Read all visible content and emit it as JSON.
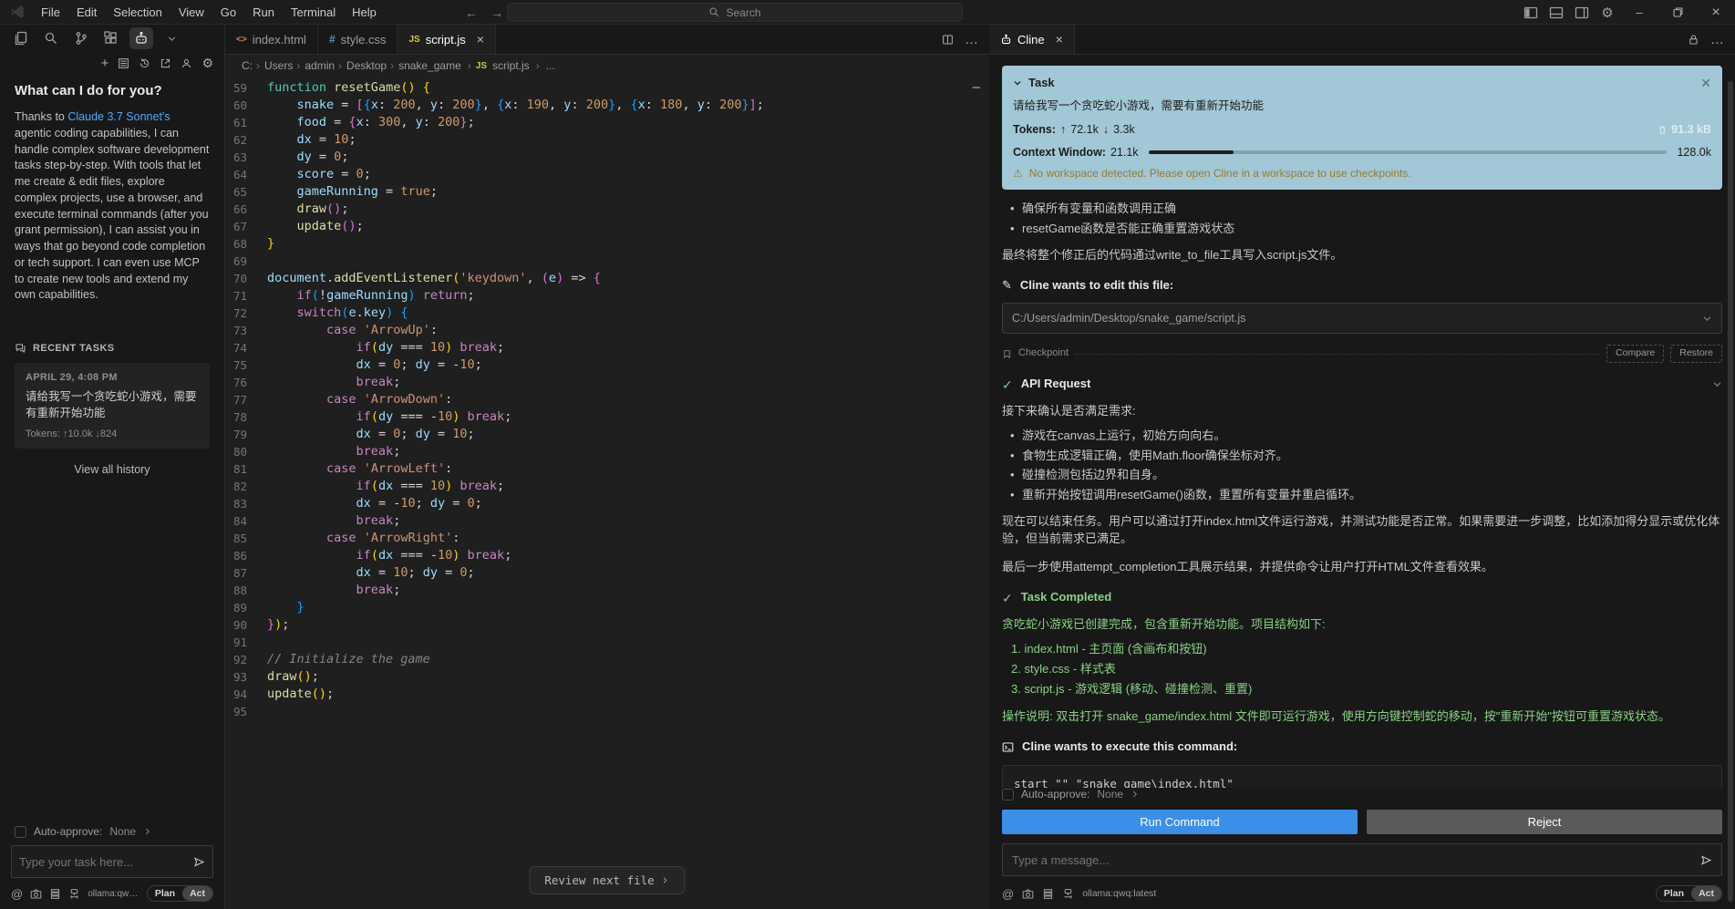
{
  "titlebar": {
    "menus": [
      "File",
      "Edit",
      "Selection",
      "View",
      "Go",
      "Run",
      "Terminal",
      "Help"
    ],
    "search_placeholder": "Search"
  },
  "sidebar": {
    "welcome_title": "What can I do for you?",
    "welcome_pre": "Thanks to ",
    "welcome_link": "Claude 3.7 Sonnet's",
    "welcome_post": " agentic coding capabilities, I can handle complex software development tasks step-by-step. With tools that let me create & edit files, explore complex projects, use a browser, and execute terminal commands (after you grant permission), I can assist you in ways that go beyond code completion or tech support. I can even use MCP to create new tools and extend my own capabilities.",
    "recent_tasks_label": "RECENT TASKS",
    "task_card": {
      "date": "APRIL 29, 4:08 PM",
      "text": "请给我写一个贪吃蛇小游戏，需要有重新开始功能",
      "tokens": "Tokens: ↑10.0k ↓824"
    },
    "view_all_history": "View all history",
    "auto_approve_label": "Auto-approve:",
    "auto_approve_value": "None",
    "input_placeholder": "Type your task here...",
    "model_label": "ollama:qwq:la...",
    "plan_label": "Plan",
    "act_label": "Act"
  },
  "editor": {
    "tabs": [
      {
        "label": "index.html"
      },
      {
        "label": "style.css"
      },
      {
        "label": "script.js"
      }
    ],
    "breadcrumb_path": [
      "C:",
      "Users",
      "admin",
      "Desktop",
      "snake_game"
    ],
    "breadcrumb_file": "script.js",
    "breadcrumb_tail": "...",
    "review_next_file": "Review next file",
    "code": [
      {
        "n": "59",
        "t": "function resetGame() {"
      },
      {
        "n": "60",
        "t": "    snake = [{x: 200, y: 200}, {x: 190, y: 200}, {x: 180, y: 200}];"
      },
      {
        "n": "61",
        "t": "    food = {x: 300, y: 200};"
      },
      {
        "n": "62",
        "t": "    dx = 10;"
      },
      {
        "n": "63",
        "t": "    dy = 0;"
      },
      {
        "n": "64",
        "t": "    score = 0;"
      },
      {
        "n": "65",
        "t": "    gameRunning = true;"
      },
      {
        "n": "66",
        "t": "    draw();"
      },
      {
        "n": "67",
        "t": "    update();"
      },
      {
        "n": "68",
        "t": "}"
      },
      {
        "n": "69",
        "t": ""
      },
      {
        "n": "70",
        "t": "document.addEventListener('keydown', (e) => {"
      },
      {
        "n": "71",
        "t": "    if(!gameRunning) return;"
      },
      {
        "n": "72",
        "t": "    switch(e.key) {"
      },
      {
        "n": "73",
        "t": "        case 'ArrowUp':"
      },
      {
        "n": "74",
        "t": "            if(dy === 10) break;"
      },
      {
        "n": "75",
        "t": "            dx = 0; dy = -10;"
      },
      {
        "n": "76",
        "t": "            break;"
      },
      {
        "n": "77",
        "t": "        case 'ArrowDown':"
      },
      {
        "n": "78",
        "t": "            if(dy === -10) break;"
      },
      {
        "n": "79",
        "t": "            dx = 0; dy = 10;"
      },
      {
        "n": "80",
        "t": "            break;"
      },
      {
        "n": "81",
        "t": "        case 'ArrowLeft':"
      },
      {
        "n": "82",
        "t": "            if(dx === 10) break;"
      },
      {
        "n": "83",
        "t": "            dx = -10; dy = 0;"
      },
      {
        "n": "84",
        "t": "            break;"
      },
      {
        "n": "85",
        "t": "        case 'ArrowRight':"
      },
      {
        "n": "86",
        "t": "            if(dx === -10) break;"
      },
      {
        "n": "87",
        "t": "            dx = 10; dy = 0;"
      },
      {
        "n": "88",
        "t": "            break;"
      },
      {
        "n": "89",
        "t": "    }"
      },
      {
        "n": "90",
        "t": "});"
      },
      {
        "n": "91",
        "t": ""
      },
      {
        "n": "92",
        "t": "// Initialize the game"
      },
      {
        "n": "93",
        "t": "draw();"
      },
      {
        "n": "94",
        "t": "update();"
      },
      {
        "n": "95",
        "t": ""
      }
    ]
  },
  "panel": {
    "tab_label": "Cline",
    "task": {
      "header": "Task",
      "text": "请给我写一个贪吃蛇小游戏，需要有重新开始功能",
      "tokens_label": "Tokens:",
      "tokens_up": "72.1k",
      "tokens_down": "3.3k",
      "cache_size": "91.3 kB",
      "context_label": "Context Window:",
      "context_used": "21.1k",
      "context_max": "128.0k",
      "warning": "No workspace detected. Please open Cline in a workspace to use checkpoints."
    },
    "bullets_top": [
      "确保所有变量和函数调用正确",
      "resetGame函数是否能正确重置游戏状态"
    ],
    "para_write": "最终将整个修正后的代码通过write_to_file工具写入script.js文件。",
    "edit_header": "Cline wants to edit this file:",
    "edit_path": "C:/Users/admin/Desktop/snake_game/script.js",
    "checkpoint_label": "Checkpoint",
    "compare_label": "Compare",
    "restore_label": "Restore",
    "api_request_label": "API Request",
    "confirm_intro": "接下来确认是否满足需求:",
    "confirm_bullets": [
      "游戏在canvas上运行，初始方向向右。",
      "食物生成逻辑正确，使用Math.floor确保坐标对齐。",
      "碰撞检测包括边界和自身。",
      "重新开始按钮调用resetGame()函数，重置所有变量并重启循环。"
    ],
    "para_end1": "现在可以结束任务。用户可以通过打开index.html文件运行游戏，并测试功能是否正常。如果需要进一步调整，比如添加得分显示或优化体验，但当前需求已满足。",
    "para_end2": "最后一步使用attempt_completion工具展示结果，并提供命令让用户打开HTML文件查看效果。",
    "task_completed_label": "Task Completed",
    "completed_intro": "贪吃蛇小游戏已创建完成，包含重新开始功能。项目结构如下:",
    "completed_list": [
      "index.html - 主页面 (含画布和按钮)",
      "style.css - 样式表",
      "script.js - 游戏逻辑 (移动、碰撞检测、重置)"
    ],
    "completed_note": "操作说明: 双击打开 snake_game/index.html 文件即可运行游戏，使用方向键控制蛇的移动，按\"重新开始\"按钮可重置游戏状态。",
    "execute_header": "Cline wants to execute this command:",
    "command": "start \"\" \"snake_game\\index.html\"",
    "auto_approve_label": "Auto-approve:",
    "auto_approve_value": "None",
    "run_button": "Run Command",
    "reject_button": "Reject",
    "input_placeholder": "Type a message...",
    "model_label": "ollama:qwq:latest",
    "plan_label": "Plan",
    "act_label": "Act"
  },
  "colors": {
    "accent": "#3b8fe8",
    "green": "#89d185",
    "taskbox": "#a2c7d6",
    "warn": "#9a7b25"
  }
}
